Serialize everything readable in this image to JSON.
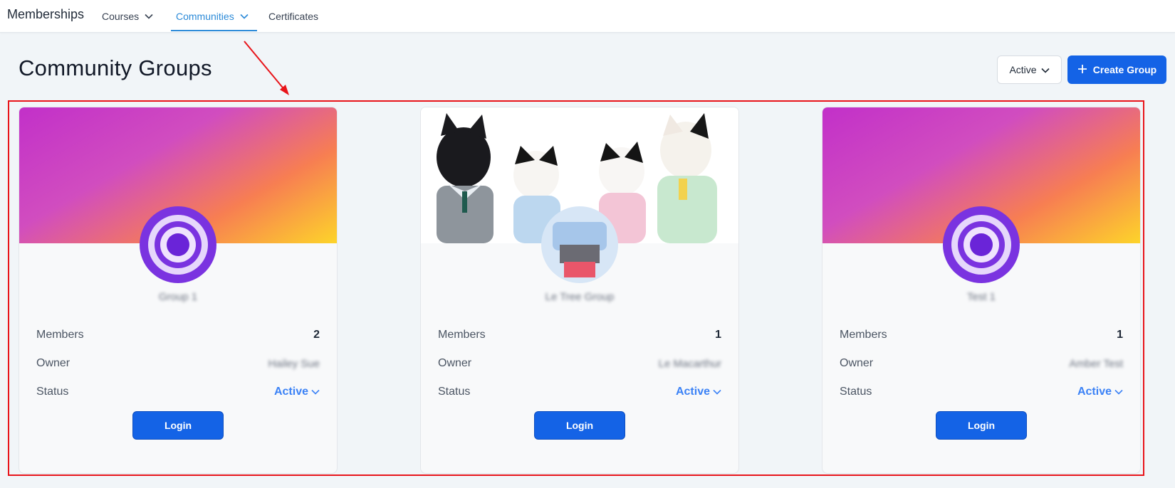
{
  "nav": {
    "brand": "Memberships",
    "items": [
      {
        "label": "Courses",
        "has_dropdown": true,
        "active": false
      },
      {
        "label": "Communities",
        "has_dropdown": true,
        "active": true
      },
      {
        "label": "Certificates",
        "has_dropdown": false,
        "active": false
      }
    ]
  },
  "page": {
    "title": "Community Groups",
    "filter_label": "Active",
    "create_label": "Create Group"
  },
  "cards": [
    {
      "name": "Group 1",
      "members_label": "Members",
      "members_count": "2",
      "owner_label": "Owner",
      "owner_name": "Hailey Sue",
      "status_label": "Status",
      "status_value": "Active",
      "login_label": "Login",
      "cover": "gradient"
    },
    {
      "name": "Le Tree Group",
      "members_label": "Members",
      "members_count": "1",
      "owner_label": "Owner",
      "owner_name": "Le Macarthur",
      "status_label": "Status",
      "status_value": "Active",
      "login_label": "Login",
      "cover": "photo"
    },
    {
      "name": "Test 1",
      "members_label": "Members",
      "members_count": "1",
      "owner_label": "Owner",
      "owner_name": "Amber Test",
      "status_label": "Status",
      "status_value": "Active",
      "login_label": "Login",
      "cover": "gradient"
    }
  ],
  "colors": {
    "accent": "#1463e6",
    "link": "#3b82f6",
    "nav_active": "#2b8ad8",
    "annotation": "#e8141a"
  }
}
